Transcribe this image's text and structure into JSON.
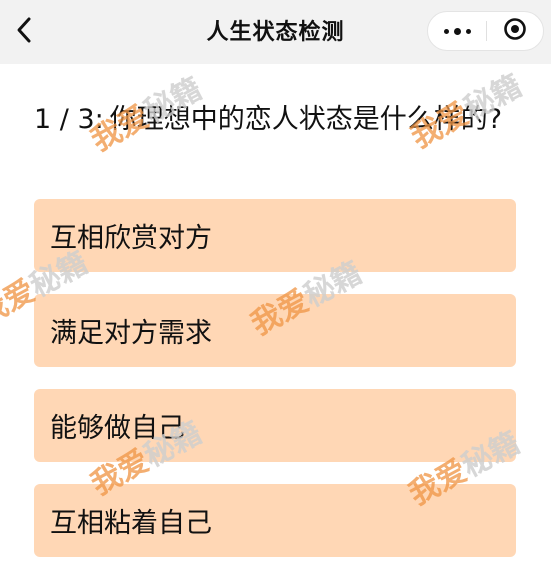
{
  "nav": {
    "title": "人生状态检测",
    "back_icon": "chevron-left-icon",
    "more_icon": "more-dots-icon",
    "close_icon": "target-circle-icon"
  },
  "question": {
    "progress": "1 / 3:",
    "text": "你理想中的恋人状态是什么样的?"
  },
  "options": [
    {
      "label": "互相欣赏对方"
    },
    {
      "label": "满足对方需求"
    },
    {
      "label": "能够做自己"
    },
    {
      "label": "互相粘着自己"
    }
  ],
  "watermark": {
    "part1": "我爱",
    "part2": "秘籍"
  },
  "colors": {
    "option_bg": "#ffd7b5",
    "nav_bg": "#f2f2f2",
    "watermark_orange": "#f09646"
  }
}
